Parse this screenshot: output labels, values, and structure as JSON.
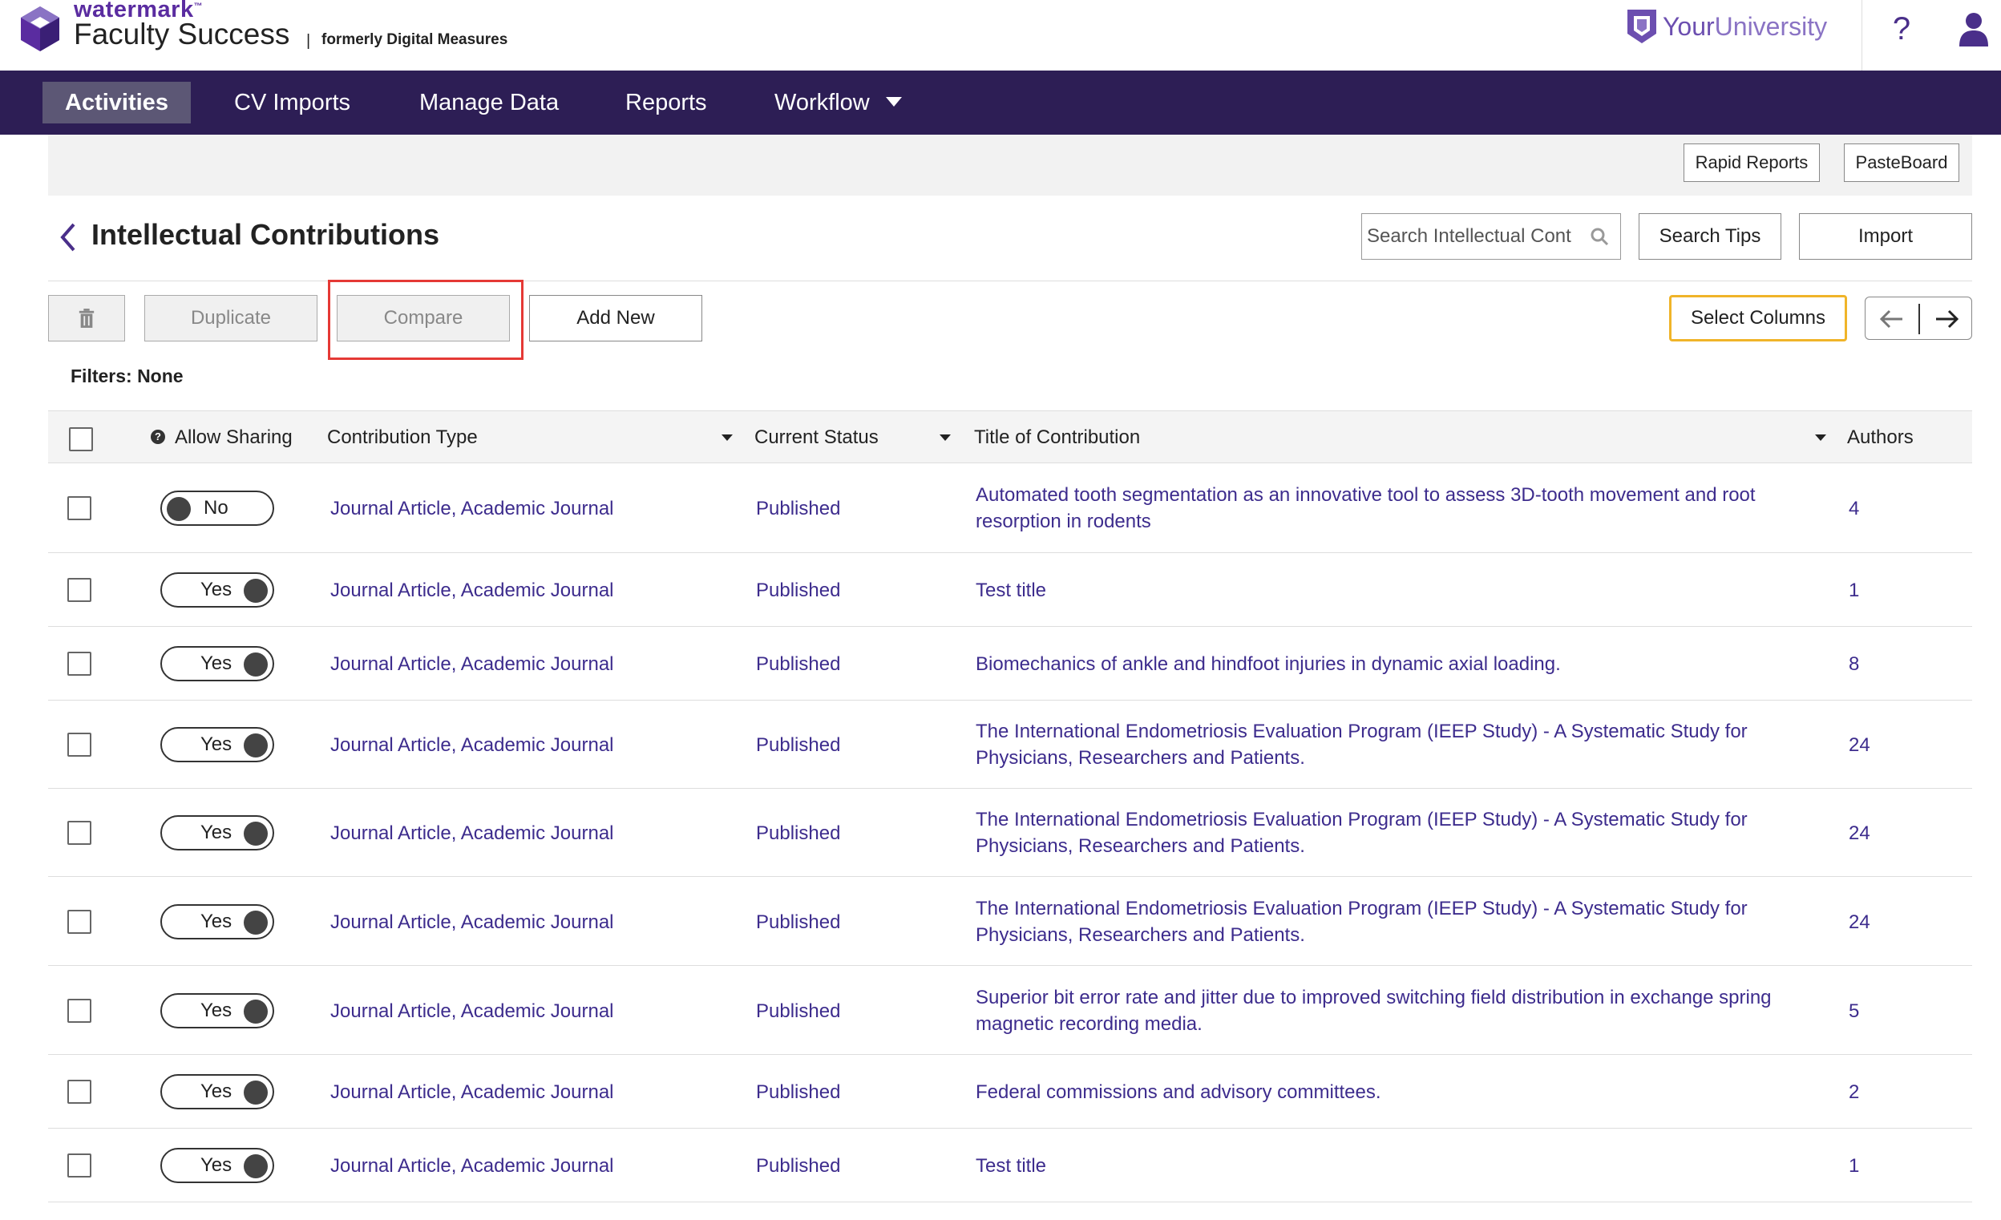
{
  "header": {
    "brand_small": "watermark",
    "brand_tm": "™",
    "brand_product": "Faculty Success",
    "brand_divider": "|",
    "brand_former": "formerly Digital Measures",
    "university_part1": "Your",
    "university_part2": "University",
    "help_label": "?"
  },
  "nav": {
    "items": [
      {
        "label": "Activities",
        "active": true
      },
      {
        "label": "CV Imports"
      },
      {
        "label": "Manage Data"
      },
      {
        "label": "Reports"
      },
      {
        "label": "Workflow"
      }
    ]
  },
  "band": {
    "rapid_reports": "Rapid Reports",
    "pasteboard": "PasteBoard"
  },
  "page": {
    "title": "Intellectual Contributions",
    "search_placeholder": "Search Intellectual Cont",
    "search_tips": "Search Tips",
    "import": "Import"
  },
  "toolbar": {
    "duplicate": "Duplicate",
    "compare": "Compare",
    "add_new": "Add New",
    "select_columns": "Select Columns"
  },
  "filters": "Filters: None",
  "table": {
    "headers": {
      "allow_sharing": "Allow Sharing",
      "contribution_type": "Contribution Type",
      "current_status": "Current Status",
      "title": "Title of Contribution",
      "authors": "Authors"
    },
    "rows": [
      {
        "sharing": "No",
        "type": "Journal Article, Academic Journal",
        "status": "Published",
        "title1": "Automated tooth segmentation as an innovative tool to assess 3D-tooth movement and root",
        "title2": "resorption in rodents",
        "authors": "4"
      },
      {
        "sharing": "Yes",
        "type": "Journal Article, Academic Journal",
        "status": "Published",
        "title1": "Test title",
        "title2": "",
        "authors": "1"
      },
      {
        "sharing": "Yes",
        "type": "Journal Article, Academic Journal",
        "status": "Published",
        "title1": "Biomechanics of ankle and hindfoot injuries in dynamic axial loading.",
        "title2": "",
        "authors": "8"
      },
      {
        "sharing": "Yes",
        "type": "Journal Article, Academic Journal",
        "status": "Published",
        "title1": "The International Endometriosis Evaluation Program (IEEP Study) - A Systematic Study for",
        "title2": "Physicians, Researchers and Patients.",
        "authors": "24"
      },
      {
        "sharing": "Yes",
        "type": "Journal Article, Academic Journal",
        "status": "Published",
        "title1": "The International Endometriosis Evaluation Program (IEEP Study) - A Systematic Study for",
        "title2": "Physicians, Researchers and Patients.",
        "authors": "24"
      },
      {
        "sharing": "Yes",
        "type": "Journal Article, Academic Journal",
        "status": "Published",
        "title1": "The International Endometriosis Evaluation Program (IEEP Study) - A Systematic Study for",
        "title2": "Physicians, Researchers and Patients.",
        "authors": "24"
      },
      {
        "sharing": "Yes",
        "type": "Journal Article, Academic Journal",
        "status": "Published",
        "title1": "Superior bit error rate and jitter due to improved switching field distribution in exchange spring",
        "title2": "magnetic recording media.",
        "authors": "5"
      },
      {
        "sharing": "Yes",
        "type": "Journal Article, Academic Journal",
        "status": "Published",
        "title1": "Federal commissions and advisory committees.",
        "title2": "",
        "authors": "2"
      },
      {
        "sharing": "Yes",
        "type": "Journal Article, Academic Journal",
        "status": "Published",
        "title1": "Test title",
        "title2": "",
        "authors": "1"
      }
    ]
  },
  "colors": {
    "brand_purple": "#5a2ca0",
    "nav_bg": "#2d1e55",
    "link": "#3d2c8d",
    "highlight_red": "#e53935",
    "select_columns_border": "#f0b429"
  },
  "icons": [
    "watermark-logo-icon",
    "university-shield-icon",
    "help-icon",
    "user-icon",
    "chevron-left-icon",
    "search-icon",
    "trash-icon",
    "arrow-left-icon",
    "arrow-right-icon",
    "info-icon"
  ]
}
